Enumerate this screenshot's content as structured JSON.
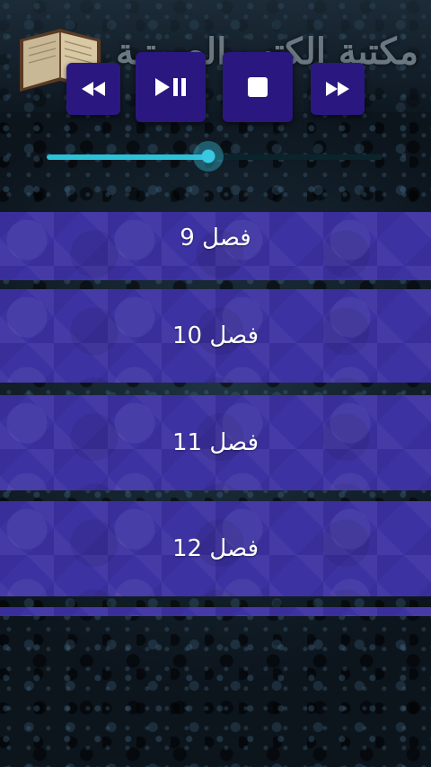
{
  "header": {
    "title": "مكتبة الكتب الصوتية",
    "book_icon": "book-icon"
  },
  "player": {
    "rewind_icon": "rewind-icon",
    "play_pause_icon": "play-pause-icon",
    "stop_icon": "stop-icon",
    "forward_icon": "fast-forward-icon",
    "progress": 0.48
  },
  "chapters": [
    {
      "label": "فصل 9"
    },
    {
      "label": "فصل 10"
    },
    {
      "label": "فصل 11"
    },
    {
      "label": "فصل 12"
    },
    {
      "label": ""
    }
  ],
  "colors": {
    "button_bg": "#2a1880",
    "list_item_bg": "#3d32a2",
    "seek_accent": "#2bc1d8",
    "background": "#0f1a24"
  }
}
